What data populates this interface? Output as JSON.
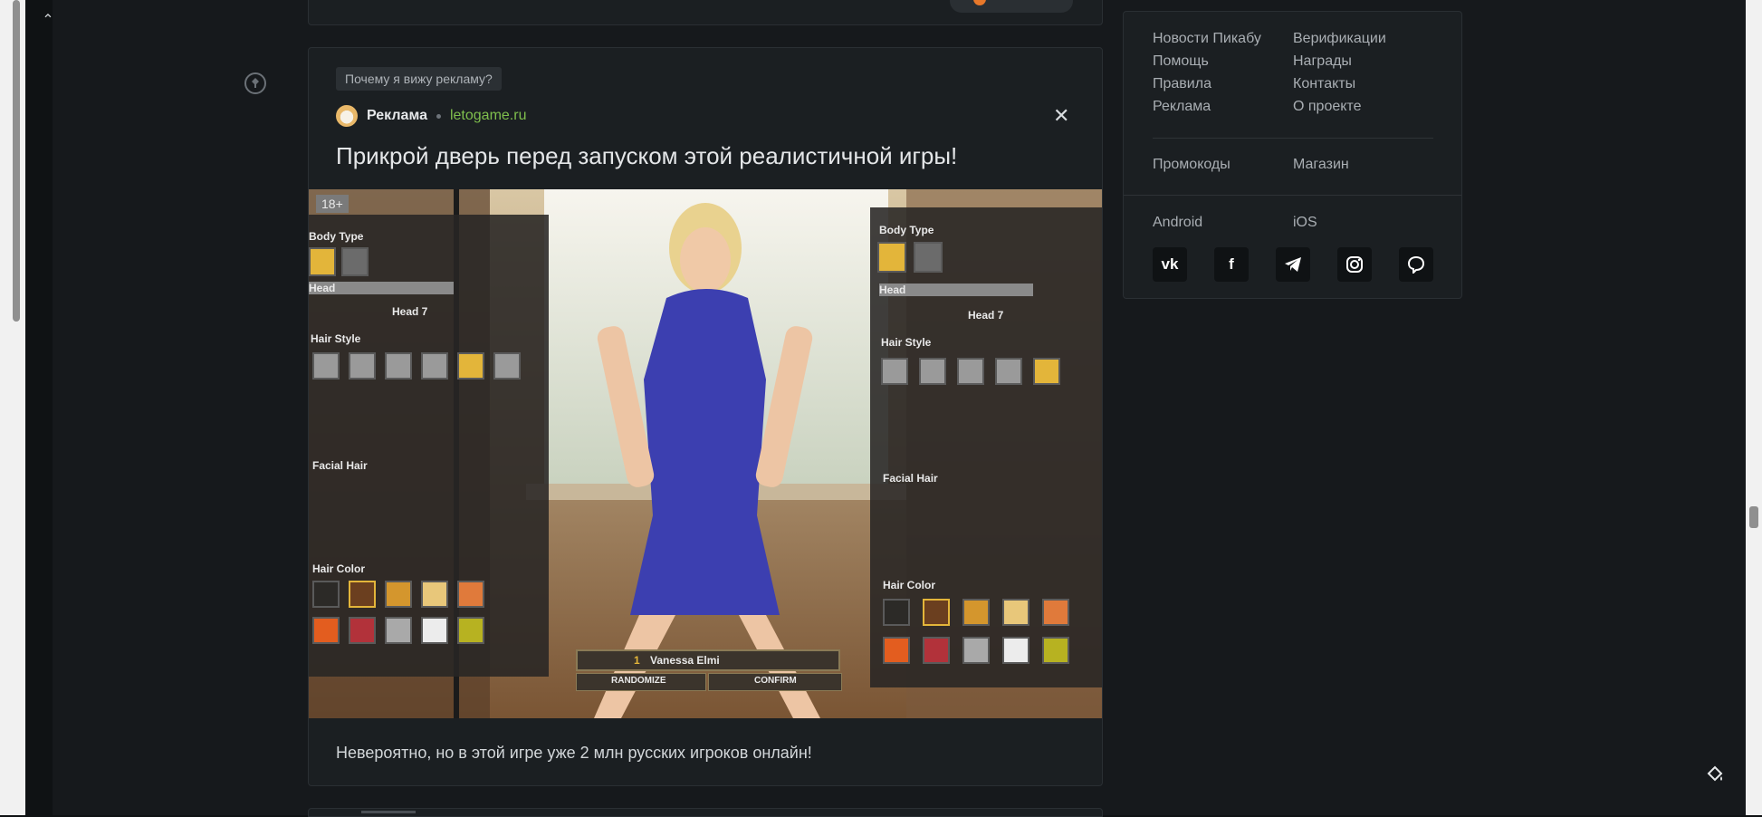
{
  "previous_post": {},
  "ad": {
    "why_label": "Почему я вижу рекламу?",
    "author": "Реклама",
    "domain": "letogame.ru",
    "title": "Прикрой дверь перед запуском этой реалистичной игры!",
    "body_text": "Невероятно, но в этой игре уже 2 млн русских игроков онлайн!",
    "image": {
      "age_badge": "18+",
      "left_panel": {
        "body_type": "Body Type",
        "head_section": "Head",
        "head_value": "Head 7",
        "hair_style": "Hair Style",
        "facial_hair": "Facial Hair",
        "hair_color": "Hair Color"
      },
      "right_panel": {
        "body_type": "Body Type",
        "head_section": "Head",
        "head_value": "Head 7",
        "hair_style": "Hair Style",
        "facial_hair": "Facial Hair",
        "hair_color": "Hair Color"
      },
      "character_name_number": "1",
      "character_name": "Vanessa Elmi",
      "randomize": "RANDOMIZE",
      "confirm": "CONFIRM"
    }
  },
  "sidebar": {
    "links": [
      "Новости Пикабу",
      "Верификации",
      "Помощь",
      "Награды",
      "Правила",
      "Контакты",
      "Реклама",
      "О проекте"
    ],
    "links2": [
      "Промокоды",
      "Магазин"
    ],
    "apps": [
      "Android",
      "iOS"
    ],
    "socials": [
      "vk-icon",
      "facebook-icon",
      "telegram-icon",
      "instagram-icon",
      "viber-icon"
    ]
  },
  "colors": {
    "background": "#16191c",
    "card": "#1b1f22",
    "domain_green": "#7fbf4d"
  }
}
